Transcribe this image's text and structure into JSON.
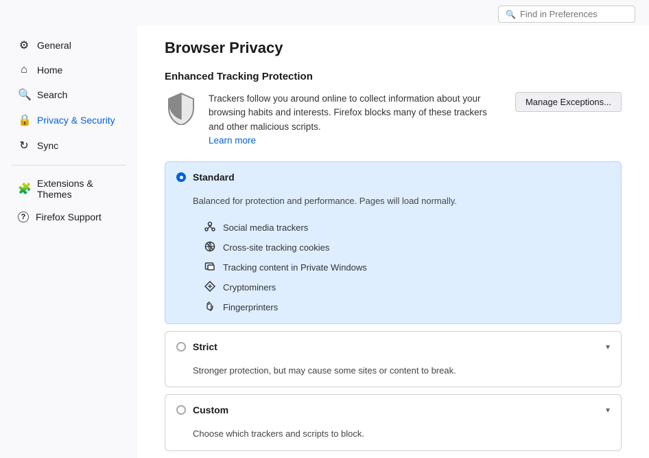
{
  "topbar": {
    "search_placeholder": "Find in Preferences"
  },
  "sidebar": {
    "items": [
      {
        "id": "general",
        "label": "General",
        "icon": "⚙"
      },
      {
        "id": "home",
        "label": "Home",
        "icon": "⌂"
      },
      {
        "id": "search",
        "label": "Search",
        "icon": "🔍"
      },
      {
        "id": "privacy",
        "label": "Privacy & Security",
        "icon": "🔒",
        "active": true
      }
    ],
    "sync_item": {
      "id": "sync",
      "label": "Sync",
      "icon": "↻"
    },
    "footer_items": [
      {
        "id": "extensions",
        "label": "Extensions & Themes",
        "icon": "🧩"
      },
      {
        "id": "support",
        "label": "Firefox Support",
        "icon": "?"
      }
    ]
  },
  "main": {
    "page_title": "Browser Privacy",
    "section_title": "Enhanced Tracking Protection",
    "tracking_description": "Trackers follow you around online to collect information about your browsing habits and interests. Firefox blocks many of these trackers and other malicious scripts.",
    "learn_more_label": "Learn more",
    "manage_exceptions_label": "Manage Exceptions...",
    "options": [
      {
        "id": "standard",
        "label": "Standard",
        "selected": true,
        "description": "Balanced for protection and performance. Pages will load normally.",
        "trackers": [
          {
            "icon": "🚫",
            "label": "Social media trackers"
          },
          {
            "icon": "🚫",
            "label": "Cross-site tracking cookies"
          },
          {
            "icon": "🖥",
            "label": "Tracking content in Private Windows"
          },
          {
            "icon": "⚡",
            "label": "Cryptominers"
          },
          {
            "icon": "👁",
            "label": "Fingerprinters"
          }
        ]
      },
      {
        "id": "strict",
        "label": "Strict",
        "selected": false,
        "description": "Stronger protection, but may cause some sites or content to break.",
        "collapsible": true
      },
      {
        "id": "custom",
        "label": "Custom",
        "selected": false,
        "description": "Choose which trackers and scripts to block.",
        "collapsible": true
      }
    ]
  }
}
